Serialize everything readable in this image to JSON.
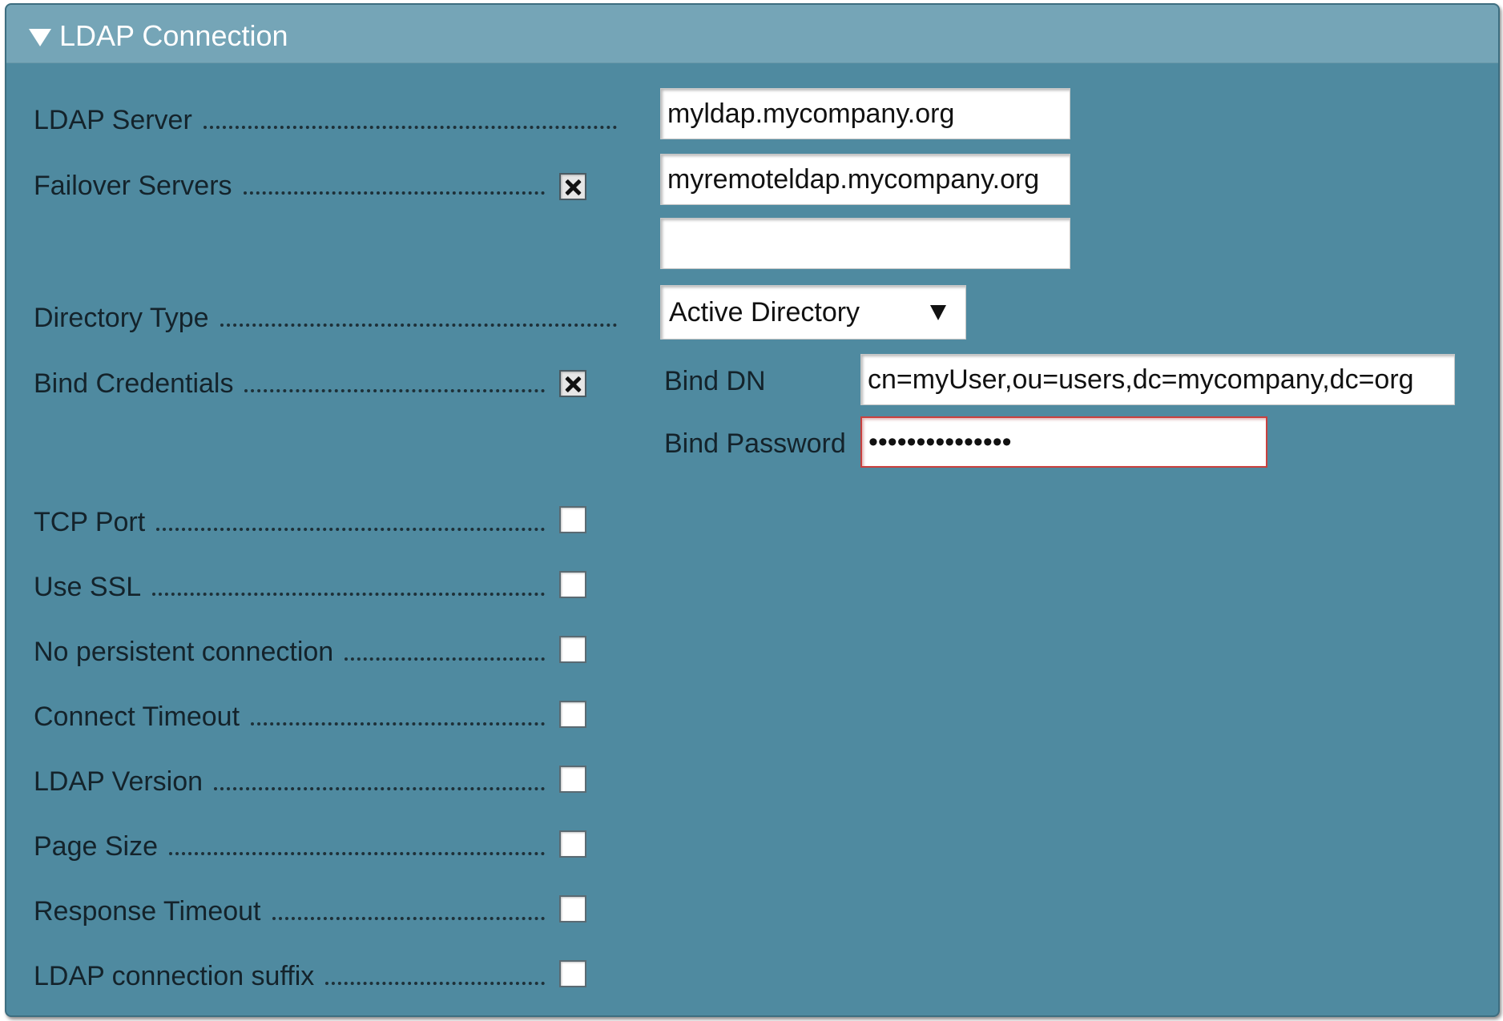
{
  "panel": {
    "title": "LDAP Connection",
    "collapse_icon": "triangle-down-icon"
  },
  "form": {
    "ldap_server": {
      "label": "LDAP Server",
      "value": "myldap.mycompany.org"
    },
    "failover_servers": {
      "label": "Failover Servers",
      "enabled": true,
      "values": [
        "myremoteldap.mycompany.org",
        ""
      ]
    },
    "directory_type": {
      "label": "Directory Type",
      "selected": "Active Directory",
      "arrow_icon": "triangle-down-icon"
    },
    "bind_credentials": {
      "label": "Bind Credentials",
      "enabled": true,
      "bind_dn_label": "Bind DN",
      "bind_dn_value": "cn=myUser,ou=users,dc=mycompany,dc=org",
      "bind_password_label": "Bind Password",
      "bind_password_value": "•••••••••••••••"
    },
    "options": [
      {
        "label": "TCP Port",
        "enabled": false
      },
      {
        "label": "Use SSL",
        "enabled": false
      },
      {
        "label": "No persistent connection",
        "enabled": false
      },
      {
        "label": "Connect Timeout",
        "enabled": false
      },
      {
        "label": "LDAP Version",
        "enabled": false
      },
      {
        "label": "Page Size",
        "enabled": false
      },
      {
        "label": "Response Timeout",
        "enabled": false
      },
      {
        "label": "LDAP connection suffix",
        "enabled": false
      }
    ]
  }
}
